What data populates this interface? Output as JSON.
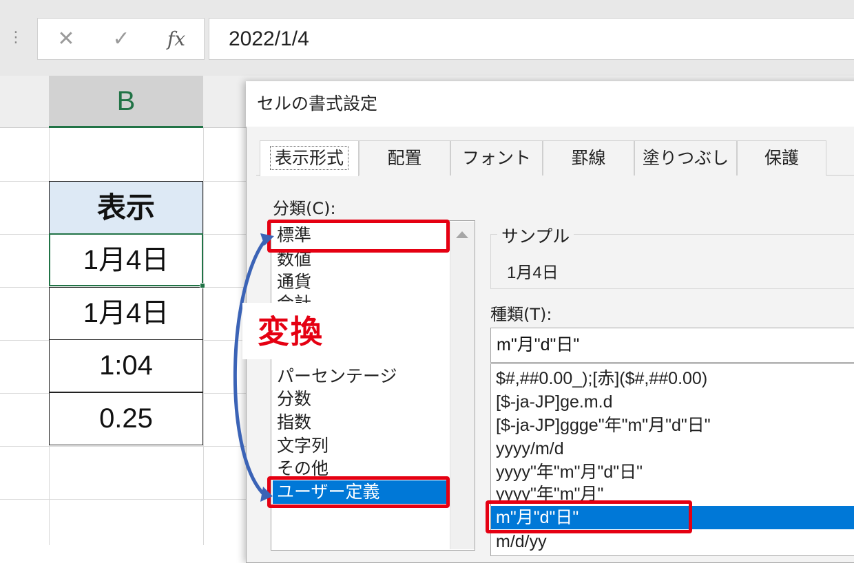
{
  "formula_bar": {
    "grip_icon": "⋮",
    "cancel_icon": "✕",
    "enter_icon": "✓",
    "fx_label": "fx",
    "value": "2022/1/4"
  },
  "sheet": {
    "column_label": "B",
    "header": "表示",
    "rows": [
      "1月4日",
      "1月4日",
      "1:04",
      "0.25"
    ]
  },
  "dialog": {
    "title": "セルの書式設定",
    "tabs": [
      "表示形式",
      "配置",
      "フォント",
      "罫線",
      "塗りつぶし",
      "保護"
    ],
    "category_label": "分類(C):",
    "categories": [
      "標準",
      "数値",
      "通貨",
      "会計",
      "パーセンテージ",
      "分数",
      "指数",
      "文字列",
      "その他",
      "ユーザー定義"
    ],
    "selected_category": "ユーザー定義",
    "sample_label": "サンプル",
    "sample_value": "1月4日",
    "type_label": "種類(T):",
    "type_value": "m\"月\"d\"日\"",
    "type_list": [
      "$#,##0.00_);[赤]($#,##0.00)",
      "[$-ja-JP]ge.m.d",
      "[$-ja-JP]ggge\"年\"m\"月\"d\"日\"",
      "yyyy/m/d",
      "yyyy\"年\"m\"月\"d\"日\"",
      "yyyy\"年\"m\"月\"",
      "m\"月\"d\"日\"",
      "m/d/yy"
    ],
    "selected_type": "m\"月\"d\"日\""
  },
  "annotation": {
    "label": "変換",
    "color": "#e50012"
  },
  "colors": {
    "excel_green": "#217346",
    "selection_blue": "#0078d7",
    "header_fill": "#dde9f5"
  }
}
